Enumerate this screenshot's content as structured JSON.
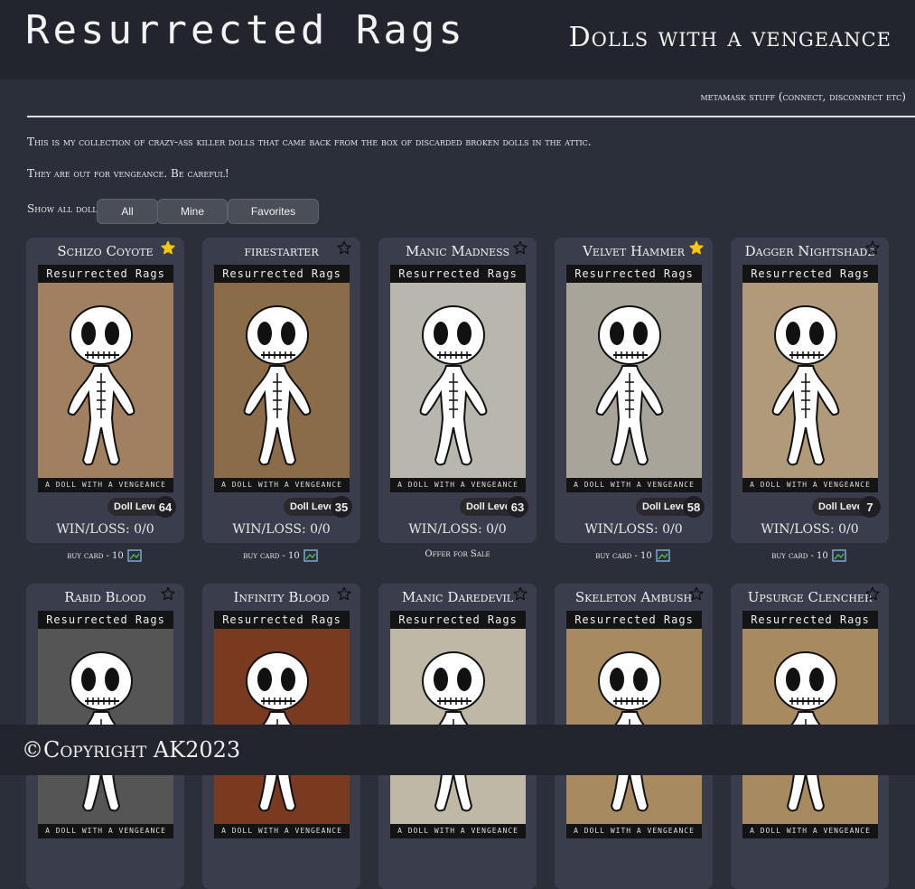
{
  "header": {
    "site_title": "Resurrected Rags",
    "tagline": "Dolls with a vengeance"
  },
  "wallet_text": "metamask stuff (connect, disconnect etc)",
  "intro": {
    "line1": "This is my collection of crazy-ass killer dolls that came back from the box of discarded broken dolls in the attic.",
    "line2": "They are out for vengeance. Be careful!"
  },
  "filters": {
    "label": "Show all dolls?",
    "all": "All",
    "mine": "Mine",
    "favorites": "Favorites"
  },
  "card_common": {
    "art_header": "Resurrected Rags",
    "art_footer": "A DOLL WITH A VENGEANCE",
    "level_label": "Doll Level"
  },
  "cards": [
    {
      "name": "Schizo Coyote",
      "favorite": true,
      "level": "64",
      "winloss": "WIN/LOSS: 0/0",
      "action": "buy card - 10",
      "bg": "#a08060"
    },
    {
      "name": "firestarter",
      "favorite": false,
      "level": "35",
      "winloss": "WIN/LOSS: 0/0",
      "action": "buy card - 10",
      "bg": "#8a6c48"
    },
    {
      "name": "Manic Madness",
      "favorite": false,
      "level": "63",
      "winloss": "WIN/LOSS: 0/0",
      "action": "Offer for Sale",
      "bg": "#b9b7ad"
    },
    {
      "name": "Velvet Hammer",
      "favorite": true,
      "level": "58",
      "winloss": "WIN/LOSS: 0/0",
      "action": "buy card - 10",
      "bg": "#a8a49a"
    },
    {
      "name": "Dagger Nightshade",
      "favorite": false,
      "level": "7",
      "winloss": "WIN/LOSS: 0/0",
      "action": "buy card - 10",
      "bg": "#b09a7a"
    },
    {
      "name": "Rabid Blood",
      "favorite": false,
      "bg": "#555555"
    },
    {
      "name": "Infinity Blood",
      "favorite": false,
      "bg": "#7a3a20"
    },
    {
      "name": "Manic Daredevil",
      "favorite": false,
      "bg": "#c0b8a6"
    },
    {
      "name": "Skeleton Ambush",
      "favorite": false,
      "bg": "#a88a60"
    },
    {
      "name": "Upsurge Clencher",
      "favorite": false,
      "bg": "#a88a60"
    }
  ],
  "footer": {
    "copyright": "©Copyright AK2023"
  },
  "colors": {
    "star_favorite": "#f5c518",
    "card_bg": "#3a3e4c",
    "page_bg": "#2b2f3a"
  }
}
